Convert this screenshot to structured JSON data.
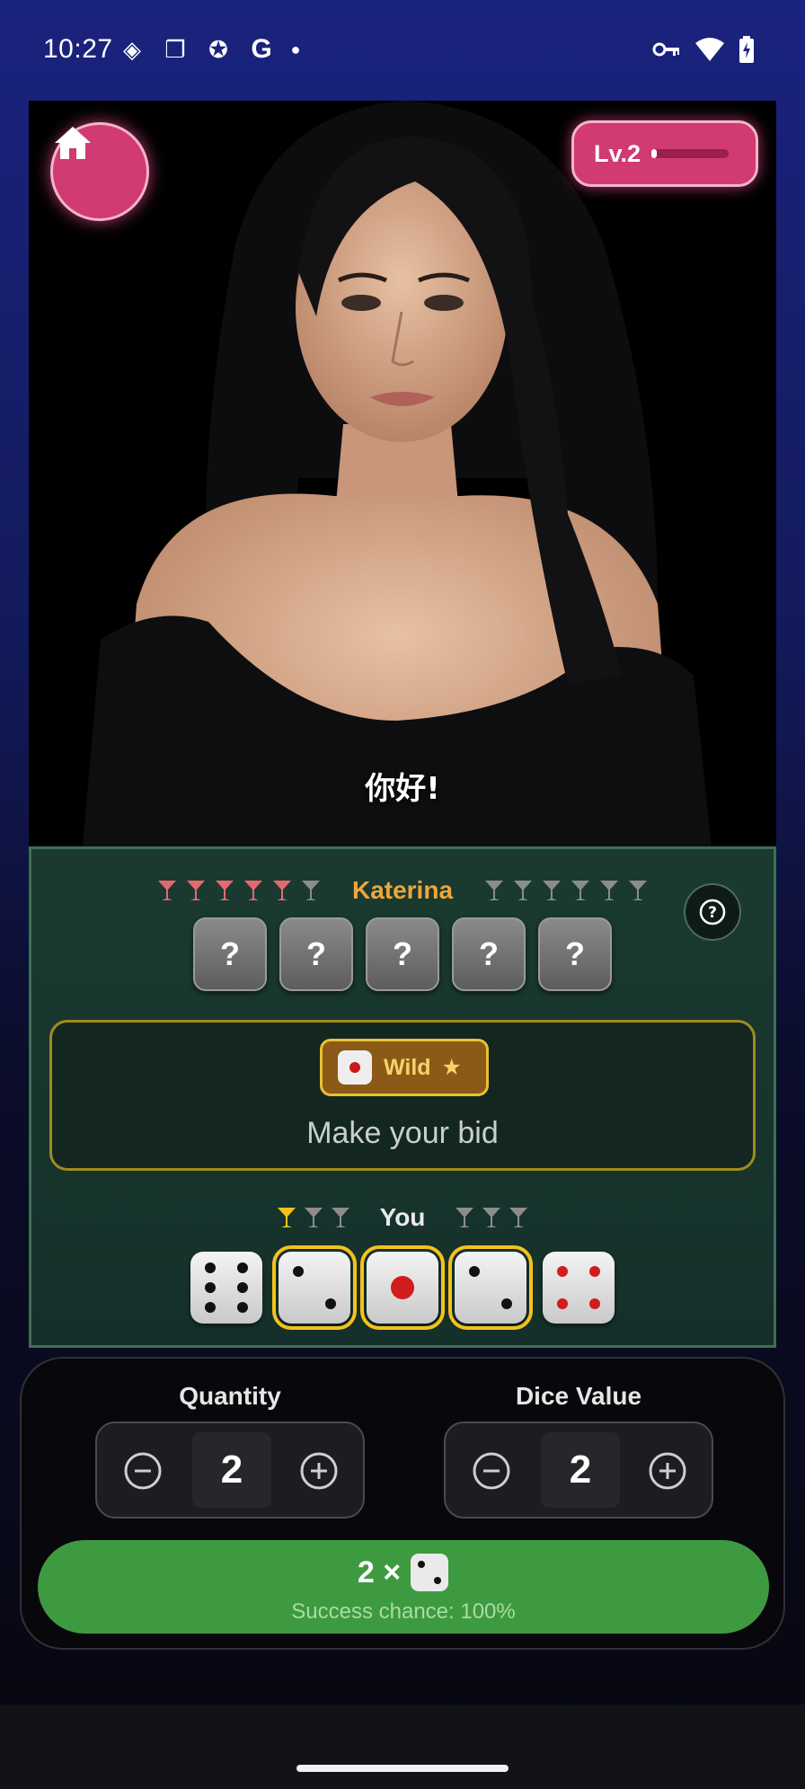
{
  "status_bar": {
    "time": "10:27"
  },
  "header": {
    "level_label": "Lv.2",
    "level_progress": 0.05
  },
  "character": {
    "speech": "你好!"
  },
  "opponent": {
    "name": "Katerina",
    "cups_active": 5,
    "cups_total": 6,
    "hidden_dice_label": "?"
  },
  "bid": {
    "wild_label": "Wild",
    "wild_star": "★",
    "prompt": "Make your bid"
  },
  "player": {
    "name": "You",
    "cups_active": 1,
    "cups_total": 3,
    "dice": [
      6,
      2,
      1,
      2,
      4
    ],
    "selected": [
      false,
      true,
      true,
      true,
      false
    ]
  },
  "controls": {
    "quantity_label": "Quantity",
    "quantity_value": "2",
    "dice_value_label": "Dice Value",
    "dice_value": "2",
    "submit_qty": "2 ×",
    "submit_chance": "Success chance: 100%"
  },
  "colors": {
    "accent_pink": "#d13a72",
    "table_green": "#1a3a30",
    "opponent_name": "#f0a63a",
    "submit_green": "#3e9a40",
    "selected_outline": "#f3c21b"
  }
}
